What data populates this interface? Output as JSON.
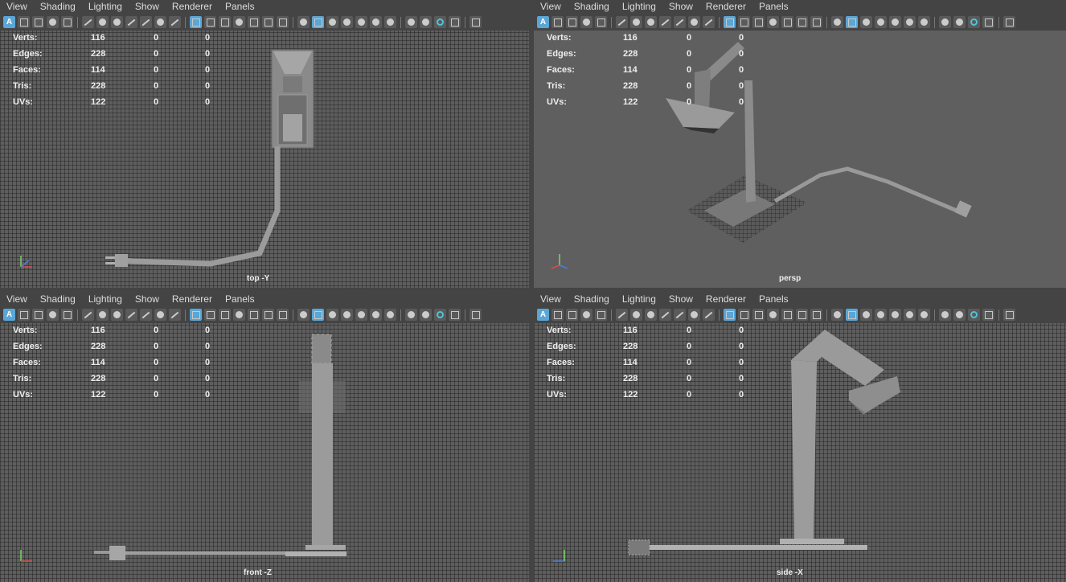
{
  "menu": [
    "View",
    "Shading",
    "Lighting",
    "Show",
    "Renderer",
    "Panels"
  ],
  "hud": {
    "rows": [
      {
        "label": "Verts:",
        "a": "116",
        "b": "0",
        "c": "0"
      },
      {
        "label": "Edges:",
        "a": "228",
        "b": "0",
        "c": "0"
      },
      {
        "label": "Faces:",
        "a": "114",
        "b": "0",
        "c": "0"
      },
      {
        "label": "Tris:",
        "a": "228",
        "b": "0",
        "c": "0"
      },
      {
        "label": "UVs:",
        "a": "122",
        "b": "0",
        "c": "0"
      }
    ]
  },
  "viewports": {
    "top": {
      "camera": "top -Y"
    },
    "persp": {
      "camera": "persp"
    },
    "front": {
      "camera": "front -Z"
    },
    "side": {
      "camera": "side -X"
    }
  },
  "toolbar_icon_a": "A",
  "colors": {
    "accent": "#5aa6d6",
    "panel": "#444444",
    "grid": "#5e5e5e"
  }
}
